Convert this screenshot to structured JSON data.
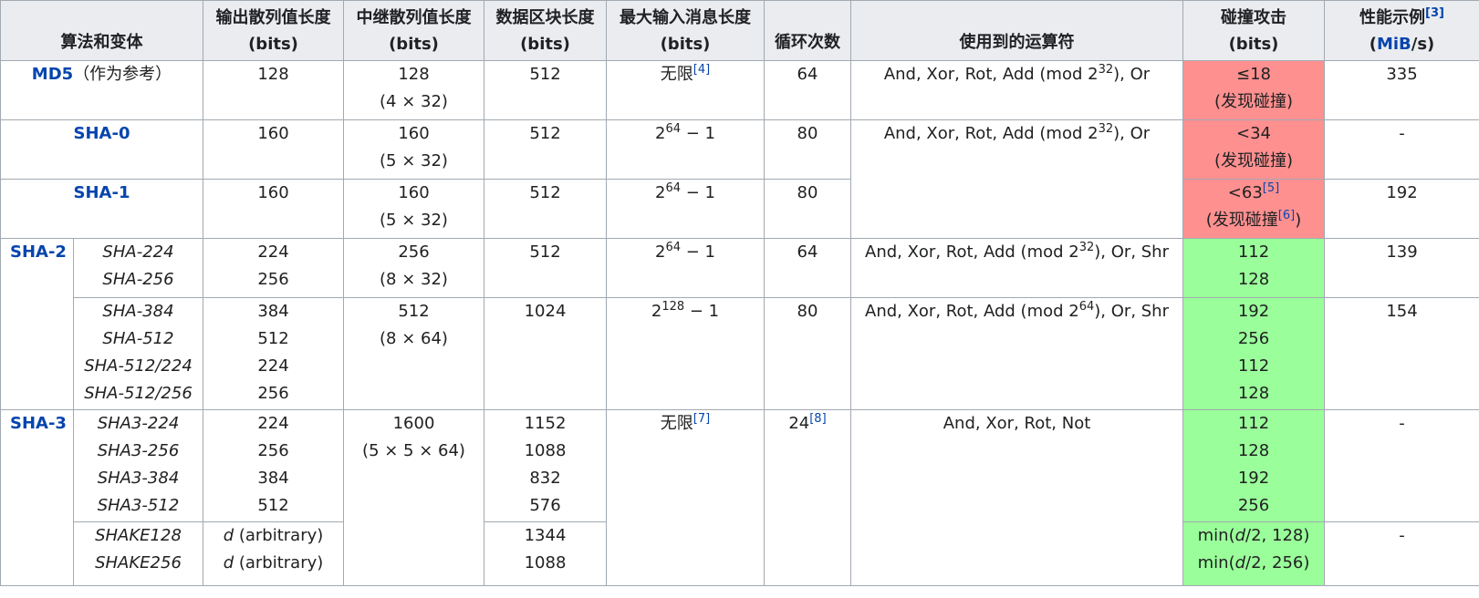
{
  "headers": {
    "variant": "算法和变体",
    "output_l1": "输出散列值长度",
    "output_l2": "(bits)",
    "internal_l1": "中继散列值长度",
    "internal_l2": "(bits)",
    "block_l1": "数据区块长度",
    "block_l2": "(bits)",
    "maxmsg_l1": "最大输入消息长度",
    "maxmsg_l2": "(bits)",
    "rounds": "循环次数",
    "ops": "使用到的运算符",
    "collision_l1": "碰撞攻击",
    "collision_l2": "(bits)",
    "perf_l1": "性能示例",
    "perf_ref": "[3]",
    "perf_l2_open": "(",
    "perf_l2_link": "MiB",
    "perf_l2_close": "/s)"
  },
  "md5": {
    "name": "MD5",
    "note": "（作为参考）",
    "output": "128",
    "internal_l1": "128",
    "internal_l2": "(4 × 32)",
    "block": "512",
    "maxmsg": "无限",
    "maxmsg_ref": "[4]",
    "rounds": "64",
    "ops_pre": "And, Xor, Rot, Add (mod 2",
    "ops_exp": "32",
    "ops_post": "), Or",
    "collision_l1": "≤18",
    "collision_l2": "(发现碰撞)",
    "perf": "335"
  },
  "sha0": {
    "name": "SHA-0",
    "output": "160",
    "internal_l1": "160",
    "internal_l2": "(5 × 32)",
    "block": "512",
    "maxmsg_base": "2",
    "maxmsg_exp": "64",
    "maxmsg_tail": " − 1",
    "rounds": "80",
    "ops_pre": "And, Xor, Rot, Add (mod 2",
    "ops_exp": "32",
    "ops_post": "), Or",
    "collision_l1": "<34",
    "collision_l2": "(发现碰撞)",
    "perf": "-"
  },
  "sha1": {
    "name": "SHA-1",
    "output": "160",
    "internal_l1": "160",
    "internal_l2": "(5 × 32)",
    "block": "512",
    "maxmsg_base": "2",
    "maxmsg_exp": "64",
    "maxmsg_tail": " − 1",
    "rounds": "80",
    "collision_l1": "<63",
    "collision_ref1": "[5]",
    "collision_l2": "(发现碰撞",
    "collision_ref2": "[6]",
    "collision_l2_close": ")",
    "perf": "192"
  },
  "sha2": {
    "family": "SHA-2",
    "a": {
      "v1": "SHA-224",
      "v2": "SHA-256",
      "out1": "224",
      "out2": "256",
      "internal_l1": "256",
      "internal_l2": "(8 × 32)",
      "block": "512",
      "maxmsg_base": "2",
      "maxmsg_exp": "64",
      "maxmsg_tail": " − 1",
      "rounds": "64",
      "ops_pre": "And, Xor, Rot, Add (mod 2",
      "ops_exp": "32",
      "ops_post": "), Or, Shr",
      "c1": "112",
      "c2": "128",
      "perf": "139"
    },
    "b": {
      "v1": "SHA-384",
      "v2": "SHA-512",
      "v3": "SHA-512/224",
      "v4": "SHA-512/256",
      "out1": "384",
      "out2": "512",
      "out3": "224",
      "out4": "256",
      "internal_l1": "512",
      "internal_l2": "(8 × 64)",
      "block": "1024",
      "maxmsg_base": "2",
      "maxmsg_exp": "128",
      "maxmsg_tail": " − 1",
      "rounds": "80",
      "ops_pre": "And, Xor, Rot, Add (mod 2",
      "ops_exp": "64",
      "ops_post": "), Or, Shr",
      "c1": "192",
      "c2": "256",
      "c3": "112",
      "c4": "128",
      "perf": "154"
    }
  },
  "sha3": {
    "family": "SHA-3",
    "a": {
      "v1": "SHA3-224",
      "v2": "SHA3-256",
      "v3": "SHA3-384",
      "v4": "SHA3-512",
      "out1": "224",
      "out2": "256",
      "out3": "384",
      "out4": "512",
      "internal_l1": "1600",
      "internal_l2": "(5 × 5 × 64)",
      "b1": "1152",
      "b2": "1088",
      "b3": "832",
      "b4": "576",
      "maxmsg": "无限",
      "maxmsg_ref": "[7]",
      "rounds": "24",
      "rounds_ref": "[8]",
      "ops": "And, Xor, Rot, Not",
      "c1": "112",
      "c2": "128",
      "c3": "192",
      "c4": "256",
      "perf": "-"
    },
    "b": {
      "v1": "SHAKE128",
      "v2": "SHAKE256",
      "out_var": "d",
      "out_text": " (arbitrary)",
      "b1": "1344",
      "b2": "1088",
      "c_pre": "min(",
      "c_var": "d",
      "c1_post": "/2, 128)",
      "c2_post": "/2, 256)",
      "perf": "-"
    }
  }
}
